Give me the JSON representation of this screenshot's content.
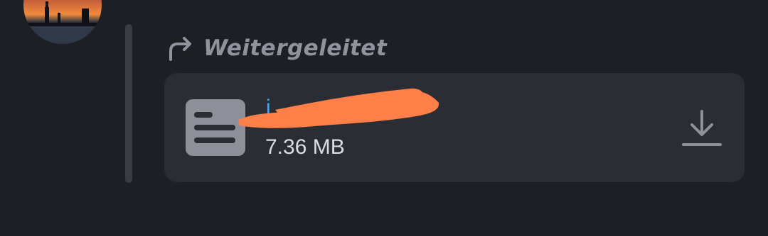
{
  "forward": {
    "label": "Weitergeleitet",
    "icon": "forward-arrow-icon"
  },
  "attachment": {
    "file_name": "i",
    "file_size": "7.36 MB",
    "file_icon": "document-icon",
    "download_icon": "download-icon",
    "redaction_color": "#ff7f48"
  },
  "colors": {
    "background": "#1e1f24",
    "card": "#2b2d35",
    "link": "#4aa3e6",
    "muted": "#8f939d"
  }
}
